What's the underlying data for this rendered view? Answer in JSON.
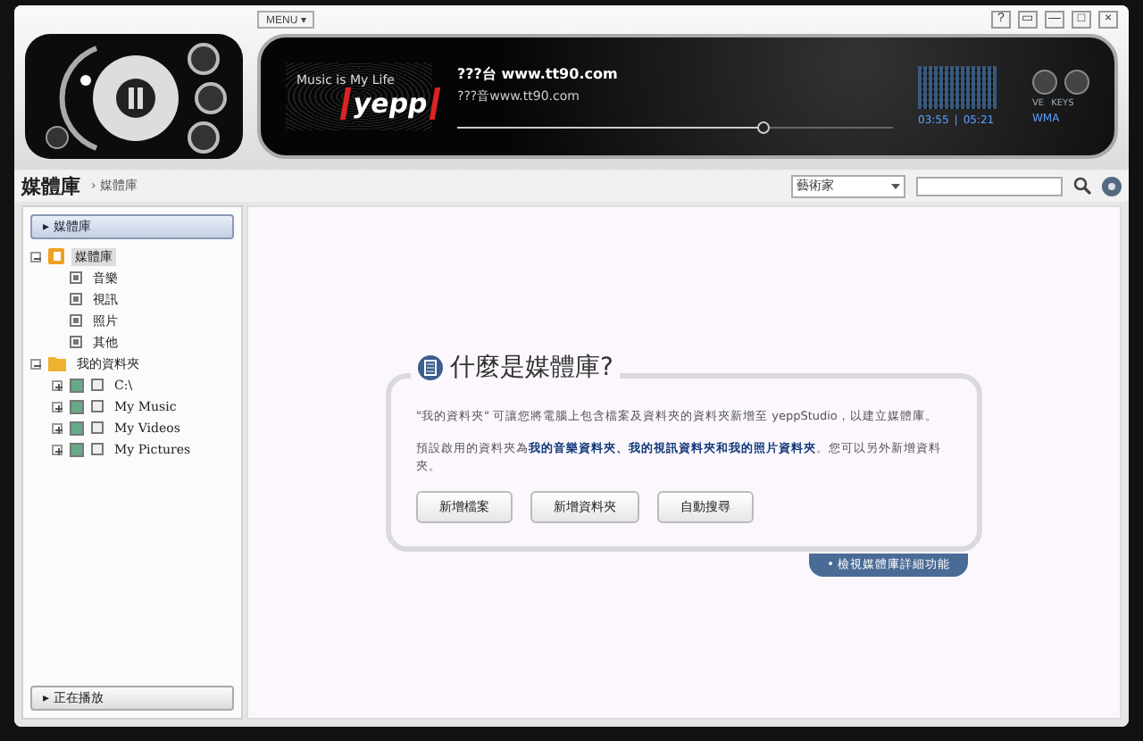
{
  "menu_button": "MENU ▾",
  "window_buttons": [
    "?",
    "▭",
    "—",
    "□",
    "×"
  ],
  "player": {
    "slogan": "Music is My Life",
    "brand": "yepp",
    "track_title": "???台 www.tt90.com",
    "track_artist": "???音www.tt90.com",
    "position": {
      "level": 0.7
    },
    "elapsed": "03:55",
    "separator": "|",
    "total": "05:21",
    "format": "WMA",
    "knob_labels": [
      "VE",
      "KEYS"
    ]
  },
  "toolbar": {
    "title": "媒體庫",
    "breadcrumb": "› 媒體庫",
    "sort": {
      "value": "藝術家"
    }
  },
  "sidebar": {
    "header": "▸ 媒體庫",
    "tree": [
      {
        "label": "媒體庫",
        "kind": "library",
        "expanded": true,
        "selected": true,
        "children": [
          {
            "label": "音樂",
            "kind": "media",
            "selected": false
          },
          {
            "label": "視訊",
            "kind": "media",
            "selected": false
          },
          {
            "label": "照片",
            "kind": "media",
            "selected": false
          },
          {
            "label": "其他",
            "kind": "media",
            "selected": false
          }
        ]
      },
      {
        "label": "我的資料夾",
        "kind": "folder",
        "expanded": true,
        "selected": false,
        "children": [
          {
            "label": "C:\\",
            "kind": "path",
            "expanded": false,
            "checked": true,
            "selected": false
          },
          {
            "label": "My Music",
            "kind": "path",
            "expanded": false,
            "checked": true,
            "selected": false
          },
          {
            "label": "My Videos",
            "kind": "path",
            "expanded": false,
            "checked": true,
            "selected": false
          },
          {
            "label": "My Pictures",
            "kind": "path",
            "expanded": false,
            "checked": true,
            "selected": false
          }
        ]
      }
    ],
    "now_playing": "▸ 正在播放"
  },
  "info_card": {
    "title": "什麼是媒體庫?",
    "paragraphs": [
      "\"我的資料夾\" 可讓您將電腦上包含檔案及資料夾的資料夾新增至 yeppStudio，以建立媒體庫。",
      "預設啟用的資料夾為**我的音樂資料夾、我的視訊資料夾和我的照片資料夾**。您可以另外新增資料夾。"
    ],
    "buttons": [
      "新增檔案",
      "新增資料夾",
      "自動搜尋"
    ],
    "link": "• 檢視媒體庫詳細功能"
  }
}
